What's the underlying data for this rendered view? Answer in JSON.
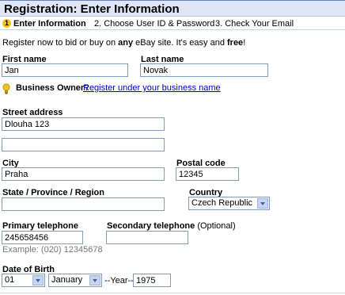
{
  "header": {
    "title": "Registration: Enter Information"
  },
  "steps": [
    {
      "num": "1",
      "label": "Enter Information"
    },
    {
      "label": "2. Choose User ID & Password"
    },
    {
      "label": "3. Check Your Email"
    }
  ],
  "intro": {
    "prefix": "Register now to bid or buy on ",
    "any": "any",
    "middle": " eBay site. It's easy and ",
    "free": "free",
    "suffix": "!"
  },
  "first_name": {
    "label": "First name",
    "value": "Jan"
  },
  "last_name": {
    "label": "Last name",
    "value": "Novak"
  },
  "business": {
    "label": "Business Owner?",
    "link": "Register under your business name"
  },
  "street": {
    "label": "Street address",
    "value": "Dlouha 123",
    "value2": ""
  },
  "city": {
    "label": "City",
    "value": "Praha"
  },
  "postal": {
    "label": "Postal code",
    "value": "12345"
  },
  "state": {
    "label": "State / Province / Region",
    "value": ""
  },
  "country": {
    "label": "Country",
    "value": "Czech Republic"
  },
  "primary_phone": {
    "label": "Primary telephone",
    "value": "245658456",
    "example": "Example: (020) 12345678"
  },
  "secondary_phone": {
    "label": "Secondary telephone",
    "optional": "(Optional)",
    "value": ""
  },
  "dob": {
    "label": "Date of Birth",
    "day": "01",
    "month": "January",
    "year_sep": "--Year--",
    "year": "1975"
  },
  "colors": {
    "header_bg": "#dfe6f5",
    "step_badge": "#f2c31a",
    "link": "#0000cc"
  },
  "icons": {
    "tip": "lightbulb-icon",
    "dropdown": "chevron-down-icon"
  }
}
